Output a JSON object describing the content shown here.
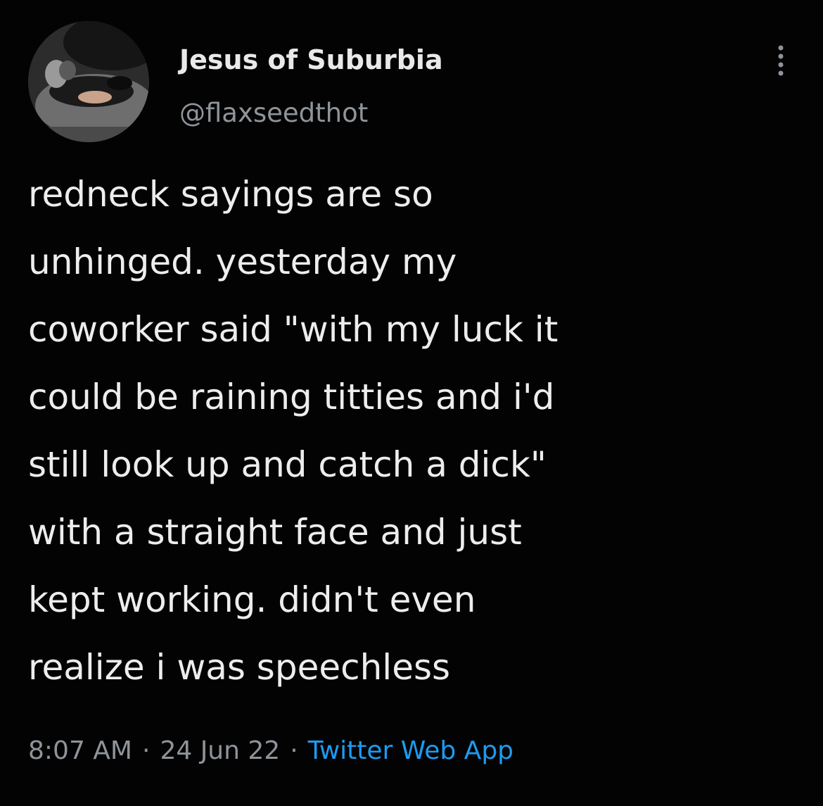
{
  "tweet": {
    "author": {
      "display_name": "Jesus of Suburbia",
      "handle": "@flaxseedthot"
    },
    "text": "redneck sayings are so\nunhinged. yesterday my\ncoworker said \"with my luck it\ncould be raining titties and i'd\nstill look up and catch a dick\"\nwith a straight face and just\nkept working. didn't even\nrealize i was speechless",
    "time": "8:07 AM",
    "date": "24 Jun 22",
    "separator": "·",
    "source": "Twitter Web App"
  },
  "icons": {
    "more": "more-options-icon",
    "avatar": "profile-photo"
  },
  "colors": {
    "background": "#030303",
    "text": "#ededed",
    "secondary_text": "#8f9499",
    "link": "#1d9bf0"
  }
}
